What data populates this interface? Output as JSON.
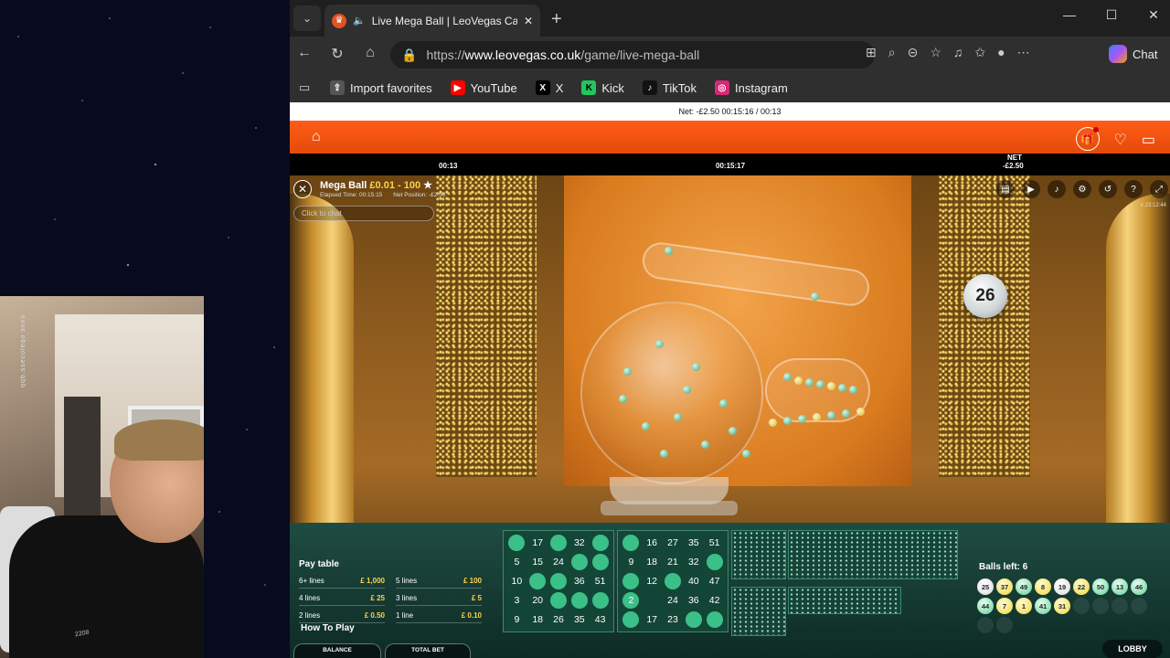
{
  "browser": {
    "tab_title": "Live Mega Ball | LeoVegas Casino",
    "url_scheme": "https://",
    "url_host": "www.leovegas.co.uk",
    "url_path": "/game/live-mega-ball",
    "chat_label": "Chat",
    "bookmarks": [
      {
        "label": "Import favorites",
        "icon": "import-icon",
        "color": "#555555"
      },
      {
        "label": "YouTube",
        "icon": "youtube-icon",
        "color": "#ff0000"
      },
      {
        "label": "X",
        "icon": "x-icon",
        "color": "#000000"
      },
      {
        "label": "Kick",
        "icon": "kick-icon",
        "color": "#22c55e"
      },
      {
        "label": "TikTok",
        "icon": "tiktok-icon",
        "color": "#111111"
      },
      {
        "label": "Instagram",
        "icon": "instagram-icon",
        "color": "#d62976"
      }
    ]
  },
  "site": {
    "status_line": "Net: -£2.50   00:15:16 / 00:13",
    "brand_color": "#ff5d17",
    "info_time": "00:13",
    "info_elapsed": "00:15:17",
    "info_net": "-£2.50",
    "info_net_label": "NET"
  },
  "game": {
    "name": "Mega Ball",
    "limits": "£0.01 - 100",
    "elapsed": "Elapsed Time: 00:15:15",
    "net_position": "Net Position: -£2.50",
    "chat_placeholder": "Click to chat",
    "round_id": "# 23:12:44",
    "current_ball": "26",
    "paytable_title": "Pay table",
    "paytable": [
      {
        "label": "6+ lines",
        "amount": "£ 1,000"
      },
      {
        "label": "5 lines",
        "amount": "£ 100"
      },
      {
        "label": "4 lines",
        "amount": "£ 25"
      },
      {
        "label": "3 lines",
        "amount": "£ 5"
      },
      {
        "label": "2 lines",
        "amount": "£ 0.50"
      },
      {
        "label": "1 line",
        "amount": "£ 0.10"
      }
    ],
    "how_to_play": "How To Play",
    "balance_label": "BALANCE",
    "total_bet_label": "TOTAL BET",
    "lobby_label": "LOBBY",
    "balls_left": "Balls left: 6",
    "drawn_balls": [
      "25",
      "37",
      "49",
      "8",
      "19",
      "22",
      "50",
      "13",
      "46",
      "44",
      "7",
      "1",
      "41",
      "31"
    ],
    "card1": [
      "",
      "17",
      "",
      "32",
      "",
      "5",
      "15",
      "24",
      "",
      "",
      "10",
      "",
      "",
      "36",
      "51",
      "3",
      "20",
      "",
      "",
      "",
      "9",
      "18",
      "26",
      "35",
      "43"
    ],
    "card2": [
      "",
      "16",
      "27",
      "35",
      "51",
      "9",
      "18",
      "21",
      "32",
      "",
      "",
      "12",
      "",
      "40",
      "47",
      "2",
      "",
      "24",
      "36",
      "42",
      "",
      "17",
      "23",
      "",
      ""
    ],
    "card1_marks": [
      0,
      2,
      4,
      8,
      9,
      11,
      12,
      17,
      18,
      19
    ],
    "card2_marks": [
      0,
      9,
      10,
      12,
      15,
      20,
      23,
      24
    ]
  },
  "webcam": {
    "watermark": "qqb.ssecoleqo suns",
    "shirt_text": "2208"
  }
}
